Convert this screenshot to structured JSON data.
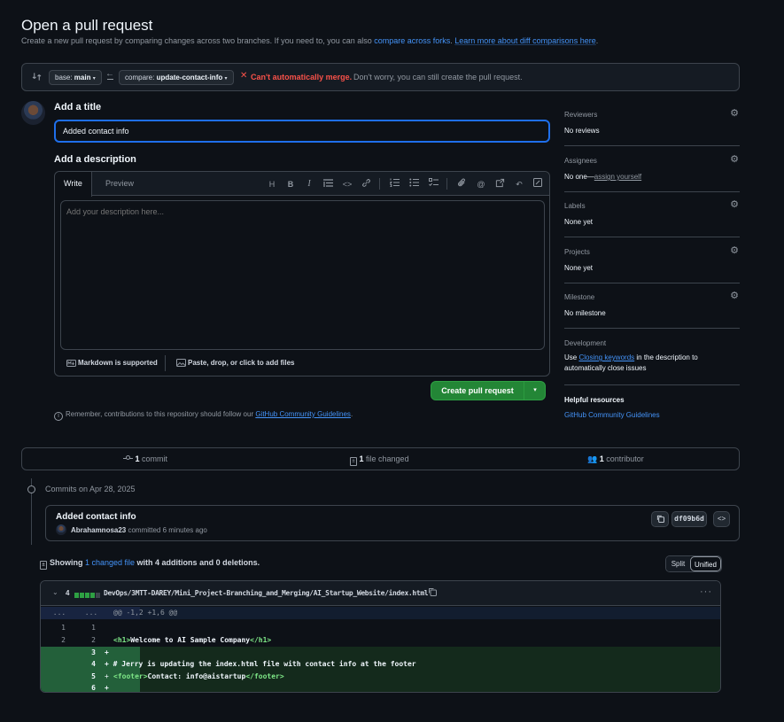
{
  "header": {
    "title": "Open a pull request",
    "subtitle_text": "Create a new pull request by comparing changes across two branches. If you need to, you can also ",
    "compare_forks_link": "compare across forks",
    "subtitle_sep": ". ",
    "learn_more_link": "Learn more about diff comparisons here",
    "subtitle_end": "."
  },
  "compare": {
    "base_label": "base: ",
    "base_branch": "main",
    "compare_label": "compare: ",
    "compare_branch": "update-contact-info",
    "merge_status": "Can't automatically merge.",
    "merge_note": "Don't worry, you can still create the pull request."
  },
  "form": {
    "title_label": "Add a title",
    "title_value": "Added contact info",
    "description_label": "Add a description",
    "write_tab": "Write",
    "preview_tab": "Preview",
    "description_placeholder": "Add your description here...",
    "markdown_note": "Markdown is supported",
    "attach_note": "Paste, drop, or click to add files",
    "create_button": "Create pull request",
    "remember_text": "Remember, contributions to this repository should follow our ",
    "guidelines_link": "GitHub Community Guidelines",
    "remember_end": "."
  },
  "sidebar": {
    "reviewers": {
      "label": "Reviewers",
      "value": "No reviews"
    },
    "assignees": {
      "label": "Assignees",
      "value": "No one—",
      "link": "assign yourself"
    },
    "labels": {
      "label": "Labels",
      "value": "None yet"
    },
    "projects": {
      "label": "Projects",
      "value": "None yet"
    },
    "milestone": {
      "label": "Milestone",
      "value": "No milestone"
    },
    "development": {
      "label": "Development",
      "text_before": "Use ",
      "link": "Closing keywords",
      "text_after": " in the description to automatically close issues"
    },
    "helpful": {
      "label": "Helpful resources",
      "link": "GitHub Community Guidelines"
    }
  },
  "stats": {
    "commits_count": "1",
    "commits_label": " commit",
    "files_count": "1",
    "files_label": " file changed",
    "contributors_count": "1",
    "contributors_label": " contributor"
  },
  "commits": {
    "date_label": "Commits on Apr 28, 2025",
    "title": "Added contact info",
    "author": "Abrahamnosa23",
    "meta": " committed 6 minutes ago",
    "sha": "df09b6d"
  },
  "summary": {
    "prefix": "Showing ",
    "changed_link": "1 changed file",
    "middle": " with ",
    "additions": "4 additions",
    "and": " and ",
    "deletions": "0 deletions",
    "end": ".",
    "split_label": "Split",
    "unified_label": "Unified"
  },
  "diff": {
    "count": "4",
    "path": "DevOps/3MTT-DAREY/Mini_Project-Branching_and_Merging/AI_Startup_Website/index.html",
    "hunk_left": "...",
    "hunk_right": "...",
    "hunk": "@@ -1,2 +1,6 @@",
    "lines": [
      {
        "old": "1",
        "new": "1",
        "type": "ctx",
        "code": ""
      },
      {
        "old": "2",
        "new": "2",
        "type": "ctx",
        "open": "<h1>",
        "text": "Welcome to AI Sample Company",
        "close": "</h1>"
      },
      {
        "old": "",
        "new": "3",
        "type": "add",
        "code": "+"
      },
      {
        "old": "",
        "new": "4",
        "type": "add",
        "code": "+ # Jerry is updating the index.html file with contact info at the footer"
      },
      {
        "old": "",
        "new": "5",
        "type": "add",
        "open": "<footer>",
        "text": "Contact: info@aistartup",
        "close": "</footer>"
      },
      {
        "old": "",
        "new": "6",
        "type": "add",
        "code": "+"
      }
    ]
  },
  "colors": {
    "accent": "#4493f8",
    "danger": "#f85149",
    "success": "#238636",
    "bg": "#0d1117"
  }
}
